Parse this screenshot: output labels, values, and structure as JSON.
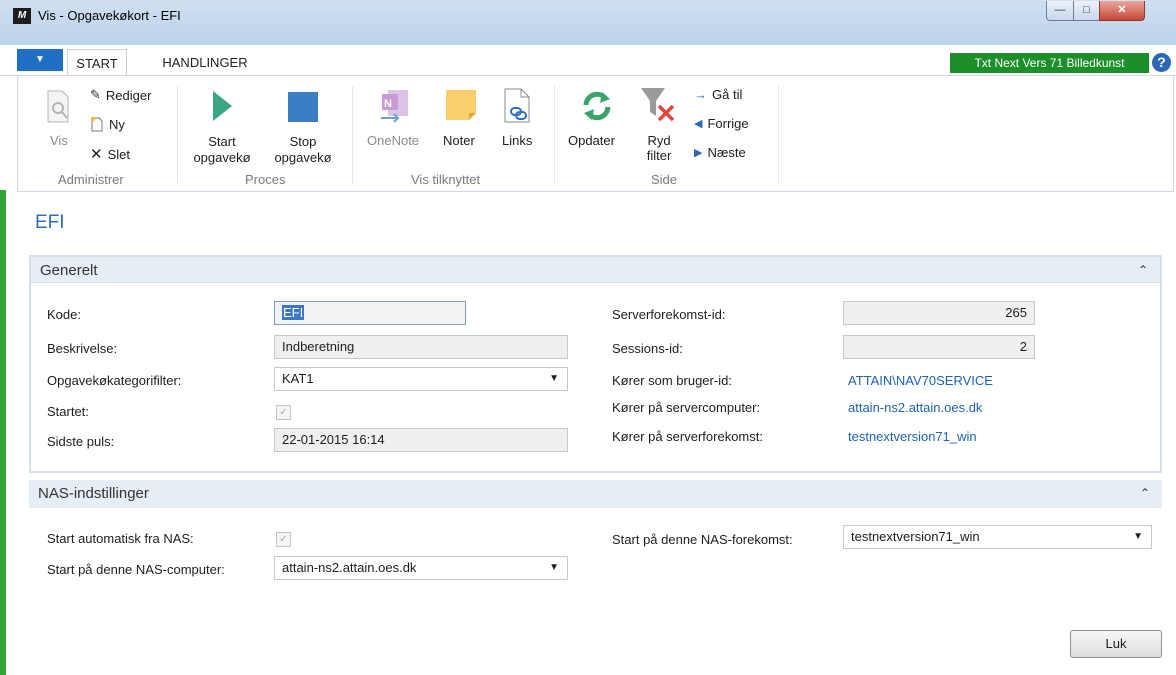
{
  "window": {
    "title": "Vis - Opgavekøkort - EFI",
    "icon_text": "M"
  },
  "ribbon": {
    "tabs": [
      "START",
      "HANDLINGER"
    ],
    "badge": "Txt Next Vers 71 Billedkunst",
    "groups": {
      "administrer": {
        "label": "Administrer",
        "vis": "Vis",
        "rediger": "Rediger",
        "ny": "Ny",
        "slet": "Slet"
      },
      "proces": {
        "label": "Proces",
        "start_line1": "Start",
        "start_line2": "opgavekø",
        "stop_line1": "Stop",
        "stop_line2": "opgavekø"
      },
      "vis_tilknyttet": {
        "label": "Vis tilknyttet",
        "onenote": "OneNote",
        "noter": "Noter",
        "links": "Links"
      },
      "side": {
        "label": "Side",
        "opdater": "Opdater",
        "ryd_line1": "Ryd",
        "ryd_line2": "filter",
        "gaa_til": "Gå til",
        "forrige": "Forrige",
        "naeste": "Næste"
      }
    }
  },
  "page": {
    "title": "EFI"
  },
  "generelt": {
    "title": "Generelt",
    "kode_label": "Kode:",
    "kode_value": "EFI",
    "beskrivelse_label": "Beskrivelse:",
    "beskrivelse_value": "Indberetning",
    "kategorifilter_label": "Opgavekøkategorifilter:",
    "kategorifilter_value": "KAT1",
    "startet_label": "Startet:",
    "puls_label": "Sidste puls:",
    "puls_value": "22-01-2015 16:14",
    "serverforekomst_label": "Serverforekomst-id:",
    "serverforekomst_value": "265",
    "sessions_label": "Sessions-id:",
    "sessions_value": "2",
    "bruger_label": "Kører som bruger-id:",
    "bruger_value": "ATTAIN\\NAV70SERVICE",
    "servercomputer_label": "Kører på servercomputer:",
    "servercomputer_value": "attain-ns2.attain.oes.dk",
    "serverinstans_label": "Kører på serverforekomst:",
    "serverinstans_value": "testnextversion71_win"
  },
  "nas": {
    "title": "NAS-indstillinger",
    "auto_label": "Start automatisk fra NAS:",
    "computer_label": "Start på denne NAS-computer:",
    "computer_value": "attain-ns2.attain.oes.dk",
    "forekomst_label": "Start på denne NAS-forekomst:",
    "forekomst_value": "testnextversion71_win"
  },
  "footer": {
    "luk": "Luk"
  }
}
